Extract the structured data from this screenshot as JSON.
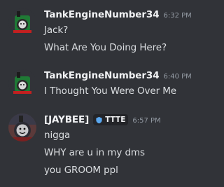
{
  "messages": [
    {
      "author": "TankEngineNumber34",
      "timestamp": "6:32 PM",
      "avatar_icon": "engine-avatar-icon",
      "lines": [
        "Jack?",
        "What Are You Doing Here?"
      ]
    },
    {
      "author": "TankEngineNumber34",
      "timestamp": "6:40 PM",
      "avatar_icon": "engine-avatar-icon",
      "lines": [
        "I Thought You Were Over Me"
      ]
    },
    {
      "author": "[JAYBEE]",
      "tag": "TTTE",
      "tag_icon": "shield-badge-icon",
      "timestamp": "6:57 PM",
      "avatar_icon": "engine-face-avatar-icon",
      "lines": [
        "nigga",
        "WHY are u in my dms",
        "you GROOM ppl"
      ]
    }
  ],
  "colors": {
    "background": "#313338",
    "username": "#f2f3f5",
    "timestamp": "#949ba4",
    "message_text": "#dbdee1",
    "tag_icon": "#5aa8f0"
  }
}
